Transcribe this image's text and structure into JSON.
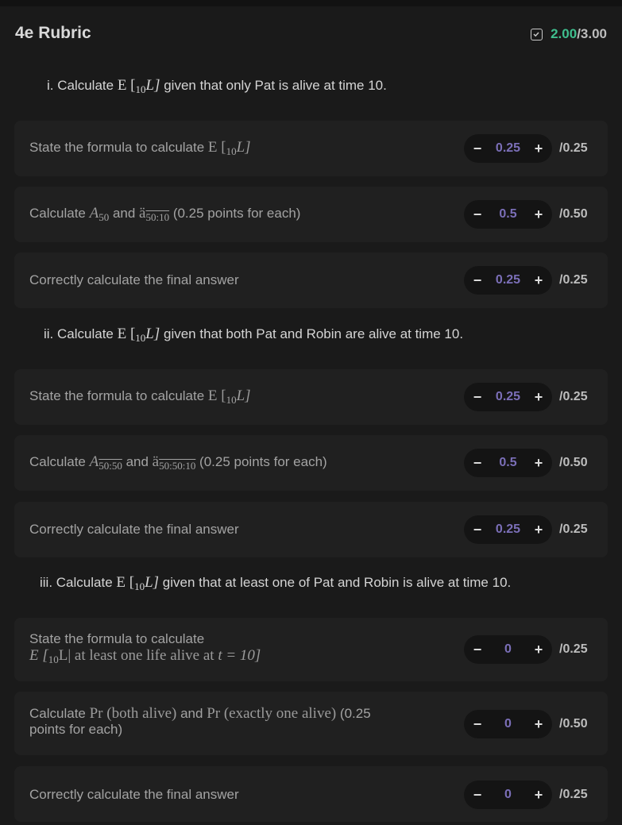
{
  "header": {
    "title": "4e Rubric",
    "score_got": "2.00",
    "score_total": "/3.00"
  },
  "sections": [
    {
      "prefix": "i. Calculate ",
      "expr": "E [",
      "sub": "10",
      "expr2": "L]",
      "suffix": " given that only Pat is alive at time 10."
    },
    {
      "prefix": "ii. Calculate ",
      "expr": "E [",
      "sub": "10",
      "expr2": "L]",
      "suffix": " given that both Pat and Robin are alive at time 10."
    },
    {
      "prefix": "iii. Calculate ",
      "expr": "E [",
      "sub": "10",
      "expr2": "L]",
      "suffix": " given that at least one of Pat and Robin is alive at time 10."
    }
  ],
  "items": [
    {
      "text": "State the formula to calculate ",
      "math": "E [",
      "sub": "10",
      "math2": "L]",
      "value": "0.25",
      "max": "/0.25"
    },
    {
      "text": "Calculate ",
      "math": "A",
      "sub": "50",
      "mid": " and ",
      "math3": "ä",
      "sub2": "50:10",
      "tail": " (0.25 points for each)",
      "value": "0.5",
      "max": "/0.50"
    },
    {
      "text": "Correctly calculate the final answer",
      "value": "0.25",
      "max": "/0.25"
    },
    {
      "text": "State the formula to calculate ",
      "math": "E [",
      "sub": "10",
      "math2": "L]",
      "value": "0.25",
      "max": "/0.25"
    },
    {
      "text": "Calculate ",
      "math": "A",
      "sub": "50:50",
      "mid": " and ",
      "math3": "ä",
      "sub2": "50:50:10",
      "tail": " (0.25 points for each)",
      "value": "0.5",
      "max": "/0.50"
    },
    {
      "text": "Correctly calculate the final answer",
      "value": "0.25",
      "max": "/0.25"
    },
    {
      "text": "State the formula to calculate",
      "line2a": "E [",
      "line2sub": "10",
      "line2b": "L| at least one life alive at ",
      "line2c": "t = 10]",
      "value": "0",
      "max": "/0.25"
    },
    {
      "text": "Calculate ",
      "math": "Pr (both alive)",
      "mid": " and ",
      "math3": "Pr (exactly one alive)",
      "tail": " (0.25",
      "line2": "points for each)",
      "value": "0",
      "max": "/0.50"
    },
    {
      "text": "Correctly calculate the final answer",
      "value": "0",
      "max": "/0.25"
    }
  ]
}
